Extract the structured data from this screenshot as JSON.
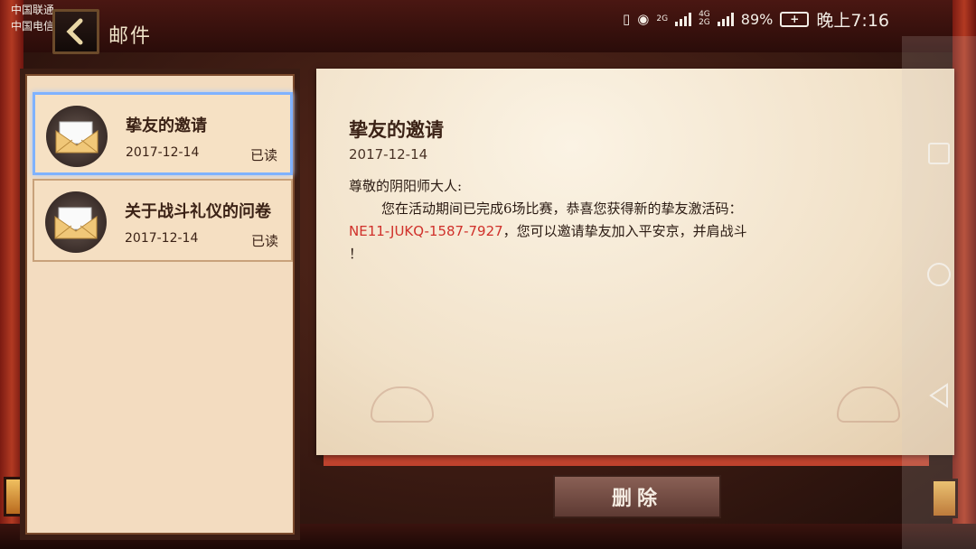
{
  "status_bar": {
    "carrier_1": "中国联通",
    "carrier_2": "中国电信",
    "net_1": "2G",
    "net_2_top": "4G",
    "net_2_bottom": "2G",
    "battery_text": "89%",
    "battery_icon": "+",
    "time": "晚上7:16"
  },
  "header": {
    "title": "邮件"
  },
  "mail_list": [
    {
      "title": "挚友的邀请",
      "date": "2017-12-14",
      "status": "已读",
      "selected": true
    },
    {
      "title": "关于战斗礼仪的问卷",
      "date": "2017-12-14",
      "status": "已读",
      "selected": false
    }
  ],
  "letter": {
    "title": "挚友的邀请",
    "date": "2017-12-14",
    "greeting": "尊敬的阴阳师大人:",
    "line1": "您在活动期间已完成6场比赛，恭喜您获得新的挚友激活码：",
    "code": "NE11-JUKQ-1587-7927",
    "line2": "，您可以邀请挚友加入平安京，并肩战斗",
    "line3": "！"
  },
  "actions": {
    "delete_label": "删除"
  },
  "icons": {
    "back": "back-arrow-icon",
    "mail": "envelope-icon",
    "nav": [
      "square-recents-icon",
      "circle-home-icon",
      "triangle-back-icon"
    ]
  },
  "colors": {
    "code_red": "#d0302a",
    "selected_border": "#7fb2ff",
    "paper": "#f3dcc0"
  }
}
